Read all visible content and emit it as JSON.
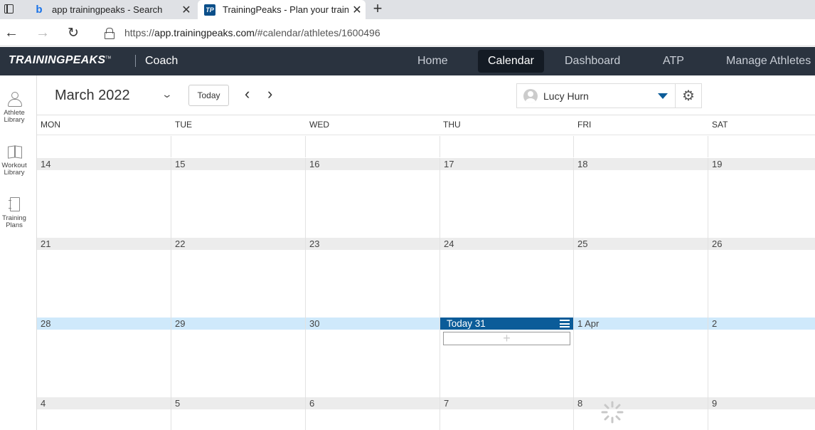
{
  "browser": {
    "tabs": [
      {
        "title": "app trainingpeaks - Search",
        "favicon": "bing-icon"
      },
      {
        "title": "TrainingPeaks - Plan your training",
        "favicon": "tp-icon"
      }
    ],
    "url_prefix": "https://",
    "url_host": "app.trainingpeaks.com",
    "url_path": "/#calendar/athletes/1600496",
    "new_tab": "+"
  },
  "app": {
    "logo": "TRAININGPEAKS",
    "logo_mark": "TM",
    "mode": "Coach",
    "nav": [
      "Home",
      "Calendar",
      "Dashboard",
      "ATP",
      "Manage Athletes"
    ],
    "active_nav": "Calendar"
  },
  "sidebar": {
    "items": [
      {
        "label": "Athlete Library",
        "icon": "athlete-icon"
      },
      {
        "label": "Workout Library",
        "icon": "book-icon"
      },
      {
        "label": "Training Plans",
        "icon": "plan-icon"
      }
    ]
  },
  "toolbar": {
    "month": "March 2022",
    "today_label": "Today",
    "athlete": "Lucy Hurn"
  },
  "calendar": {
    "days_of_week": [
      "MON",
      "TUE",
      "WED",
      "THU",
      "FRI",
      "SAT"
    ],
    "weeks": [
      {
        "days": [
          "",
          "",
          "",
          "",
          "",
          ""
        ],
        "current": false
      },
      {
        "days": [
          "14",
          "15",
          "16",
          "17",
          "18",
          "19"
        ],
        "current": false
      },
      {
        "days": [
          "21",
          "22",
          "23",
          "24",
          "25",
          "26"
        ],
        "current": false
      },
      {
        "days": [
          "28",
          "29",
          "30",
          "Today 31",
          "1 Apr",
          "2"
        ],
        "current": true,
        "today_index": 3
      },
      {
        "days": [
          "4",
          "5",
          "6",
          "7",
          "8",
          "9"
        ],
        "current": false
      }
    ],
    "add_workout": "+"
  },
  "colors": {
    "header_bg": "#2a333f",
    "accent": "#0b5c99",
    "current_week": "#cfe9fb"
  }
}
